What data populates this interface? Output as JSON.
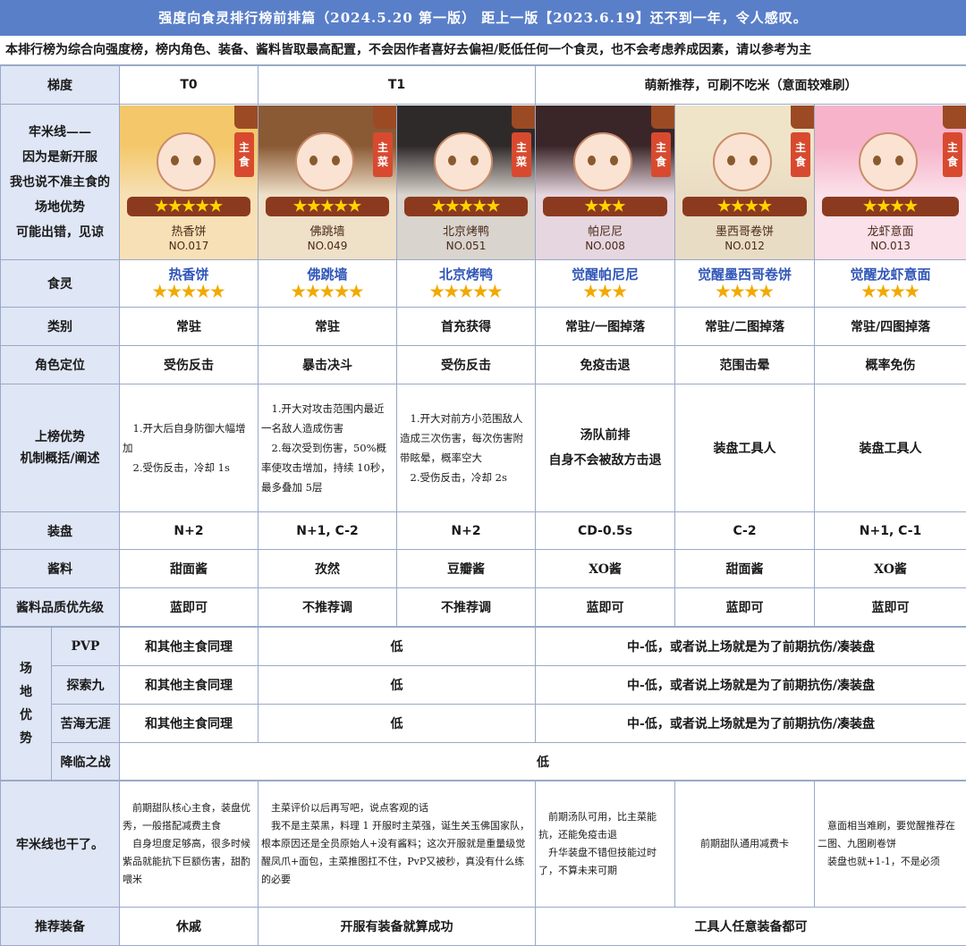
{
  "title": "强度向食灵排行榜前排篇（2024.5.20 第一版） 距上一版【2023.6.19】还不到一年，令人感叹。",
  "intro": "本排行榜为综合向强度榜，榜内角色、装备、酱料皆取最高配置，不会因作者喜好去偏袒/贬低任何一个食灵，也不会考虑养成因素，请以参考为主",
  "tiers": {
    "label": "梯度",
    "t0": "T0",
    "t1": "T1",
    "new": "萌新推荐，可刷不吃米（意面较难刷）"
  },
  "floor_note": [
    "牢米线——",
    "因为是新开服",
    "我也说不准主食的",
    "场地优势",
    "可能出错，见谅"
  ],
  "cards": [
    {
      "name": "热香饼",
      "no": "NO.017",
      "badge": "主食",
      "stars": "★★★★★",
      "hair": "#f4c86a",
      "bg": "#f7e0b5"
    },
    {
      "name": "佛跳墙",
      "no": "NO.049",
      "badge": "主菜",
      "stars": "★★★★★",
      "hair": "#8a5a35",
      "bg": "#efe0c8"
    },
    {
      "name": "北京烤鸭",
      "no": "NO.051",
      "badge": "主菜",
      "stars": "★★★★★",
      "hair": "#2f2a2a",
      "bg": "#d9d4cd"
    },
    {
      "name": "帕尼尼",
      "no": "NO.008",
      "badge": "主食",
      "stars": "★★★",
      "hair": "#3a2628",
      "bg": "#e6d6df"
    },
    {
      "name": "墨西哥卷饼",
      "no": "NO.012",
      "badge": "主食",
      "stars": "★★★★",
      "hair": "#f0e4c8",
      "bg": "#e9dcc4"
    },
    {
      "name": "龙虾意面",
      "no": "NO.013",
      "badge": "主食",
      "stars": "★★★★",
      "hair": "#f6b3c9",
      "bg": "#fbe1ea"
    }
  ],
  "rows": {
    "shiling": {
      "label": "食灵",
      "names": [
        "热香饼",
        "佛跳墙",
        "北京烤鸭",
        "觉醒帕尼尼",
        "觉醒墨西哥卷饼",
        "觉醒龙虾意面"
      ],
      "stars": [
        "★★★★★",
        "★★★★★",
        "★★★★★",
        "★★★",
        "★★★★",
        "★★★★"
      ]
    },
    "category": {
      "label": "类别",
      "values": [
        "常驻",
        "常驻",
        "首充获得",
        "常驻/一图掉落",
        "常驻/二图掉落",
        "常驻/四图掉落"
      ]
    },
    "role": {
      "label": "角色定位",
      "values": [
        "受伤反击",
        "暴击决斗",
        "受伤反击",
        "免疫击退",
        "范围击晕",
        "概率免伤"
      ]
    },
    "mech": {
      "label1": "上榜优势",
      "label2": "机制概括/阐述",
      "c1": [
        "1.开大后自身防御大幅增加",
        "2.受伤反击，冷却 1s"
      ],
      "c2": [
        "1.开大对攻击范围内最近一名敌人造成伤害",
        "2.每次受到伤害，50%概率使攻击增加，持续 10秒，最多叠加 5层"
      ],
      "c3": [
        "1.开大对前方小范围敌人造成三次伤害，每次伤害附带眩晕，概率空大",
        "2.受伤反击，冷却 2s"
      ],
      "c4": [
        "汤队前排",
        "自身不会被敌方击退"
      ],
      "c5": "装盘工具人",
      "c6": "装盘工具人"
    },
    "plate": {
      "label": "装盘",
      "values": [
        "N+2",
        "N+1, C-2",
        "N+2",
        "CD-0.5s",
        "C-2",
        "N+1, C-1"
      ]
    },
    "sauce": {
      "label": "酱料",
      "values": [
        "甜面酱",
        "孜然",
        "豆瓣酱",
        "XO酱",
        "甜面酱",
        "XO酱"
      ]
    },
    "sauce_quality": {
      "label": "酱料品质优先级",
      "values": [
        "蓝即可",
        "不推荐调",
        "不推荐调",
        "蓝即可",
        "蓝即可",
        "蓝即可"
      ]
    }
  },
  "field": {
    "label": "场地优势",
    "rows": [
      {
        "name": "PVP",
        "t0": "和其他主食同理",
        "t1": "低",
        "new": "中-低，或者说上场就是为了前期抗伤/凑装盘"
      },
      {
        "name": "探索九",
        "t0": "和其他主食同理",
        "t1": "低",
        "new": "中-低，或者说上场就是为了前期抗伤/凑装盘"
      },
      {
        "name": "苦海无涯",
        "t0": "和其他主食同理",
        "t1": "低",
        "new": "中-低，或者说上场就是为了前期抗伤/凑装盘"
      }
    ],
    "last": {
      "name": "降临之战",
      "value": "低"
    }
  },
  "floor2": {
    "label": "牢米线也干了。",
    "c1": [
      "前期甜队核心主食，装盘优秀，一般搭配减费主食",
      "自身坦度足够高，很多时候紫品就能抗下巨额伤害，甜酌喂米"
    ],
    "c23": [
      "主菜评价以后再写吧，说点客观的话",
      "我不是主菜黑，料理 1 开服时主菜强，诞生关玉佛国家队，根本原因还是全员原始人+没有酱料；这次开服就是重量级觉醒凤爪+面包，主菜推图扛不住，PvP又被秒，真没有什么练的必要"
    ],
    "c4": [
      "前期汤队可用，比主菜能抗，还能免疫击退",
      "升华装盘不错但技能过时了，不算未来可期"
    ],
    "c5": "前期甜队通用减费卡",
    "c6": [
      "意面相当难刷，要觉醒推荐在二图、九图刷卷饼",
      "装盘也就+1-1，不是必须"
    ]
  },
  "recommend": {
    "label": "推荐装备",
    "t0": "休戚",
    "t1": "开服有装备就算成功",
    "new": "工具人任意装备都可"
  }
}
